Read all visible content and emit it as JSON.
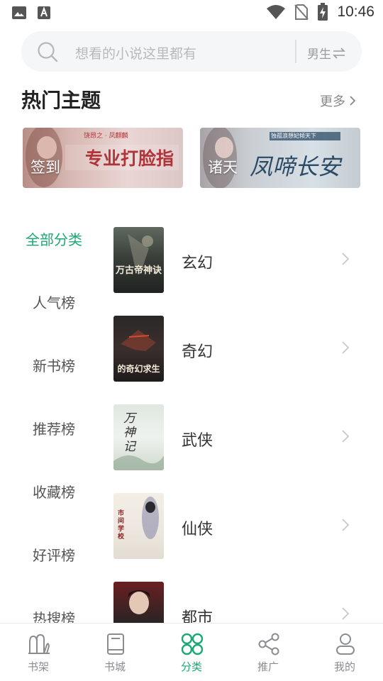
{
  "status_bar": {
    "time": "10:46",
    "icons": [
      "image-icon",
      "font-download-icon",
      "wifi-icon",
      "no-sim-icon",
      "battery-charging-icon"
    ]
  },
  "search": {
    "placeholder": "想看的小说这里都有",
    "gender_toggle": "男生"
  },
  "hot_topics": {
    "title": "热门主题",
    "more_label": "更多",
    "banners": [
      {
        "label": "签到",
        "art_text": "专业打脸指",
        "art_small": "饶昂之 · 凤麒麟"
      },
      {
        "label": "诸天",
        "art_text": "凤啼长安",
        "art_small": "独孤浪想妃倾天下"
      }
    ]
  },
  "categories": {
    "menu": [
      {
        "label": "全部分类",
        "active": true
      },
      {
        "label": "人气榜",
        "active": false
      },
      {
        "label": "新书榜",
        "active": false
      },
      {
        "label": "推荐榜",
        "active": false
      },
      {
        "label": "收藏榜",
        "active": false
      },
      {
        "label": "好评榜",
        "active": false
      },
      {
        "label": "热搜榜",
        "active": false
      }
    ],
    "items": [
      {
        "label": "玄幻",
        "cover_text": "万古帝神诀"
      },
      {
        "label": "奇幻",
        "cover_text": "的奇幻求生"
      },
      {
        "label": "武侠",
        "cover_text": "万神记"
      },
      {
        "label": "仙侠",
        "cover_text": "市间学校"
      },
      {
        "label": "都市",
        "cover_text": ""
      }
    ]
  },
  "tab_bar": {
    "tabs": [
      {
        "label": "书架",
        "icon": "bookshelf-icon",
        "active": false
      },
      {
        "label": "书城",
        "icon": "book-icon",
        "active": false
      },
      {
        "label": "分类",
        "icon": "category-grid-icon",
        "active": true
      },
      {
        "label": "推广",
        "icon": "share-icon",
        "active": false
      },
      {
        "label": "我的",
        "icon": "user-icon",
        "active": false
      }
    ]
  },
  "colors": {
    "accent": "#1ba874",
    "text_primary": "#222222",
    "text_secondary": "#888888",
    "search_bg": "#f5f6f8"
  }
}
